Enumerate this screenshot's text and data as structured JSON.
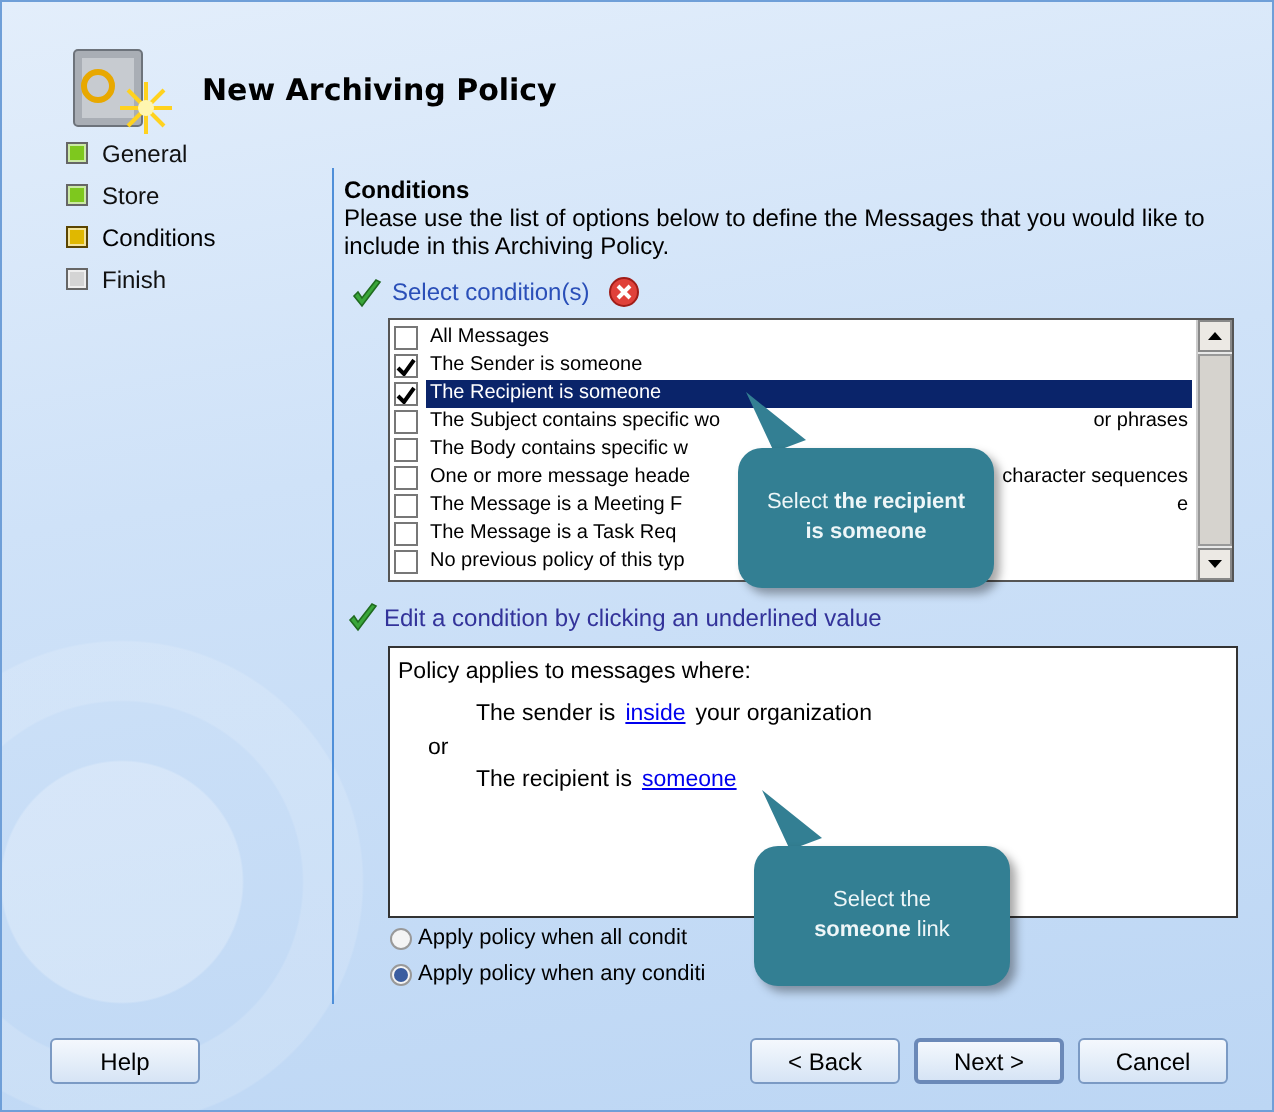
{
  "window": {
    "title": "New Archiving Policy"
  },
  "steps": [
    {
      "label": "General",
      "color": "#7ec81e",
      "selected": false
    },
    {
      "label": "Store",
      "color": "#7ec81e",
      "selected": false
    },
    {
      "label": "Conditions",
      "color": "#e0b800",
      "selected": true
    },
    {
      "label": "Finish",
      "color": "#d4d4d4",
      "selected": false
    }
  ],
  "section": {
    "heading": "Conditions",
    "description": "Please use the list of options below to define the Messages that you would like to include in this Archiving Policy."
  },
  "select_link": "Select condition(s)",
  "conditions": [
    {
      "label": "All Messages",
      "checked": false,
      "selected": false
    },
    {
      "label": "The Sender is someone",
      "checked": true,
      "selected": false
    },
    {
      "label": "The Recipient is someone",
      "checked": true,
      "selected": true
    },
    {
      "label": "The Subject contains specific wo",
      "label_end": "or phrases",
      "checked": false,
      "selected": false
    },
    {
      "label": "The Body contains specific w",
      "checked": false,
      "selected": false
    },
    {
      "label": "One or more message heade",
      "label_end": "character sequences",
      "checked": false,
      "selected": false
    },
    {
      "label": "The Message is a Meeting F",
      "label_end": "e",
      "checked": false,
      "selected": false
    },
    {
      "label": "The Message is a Task Req",
      "checked": false,
      "selected": false
    },
    {
      "label": "No previous policy of this typ",
      "checked": false,
      "selected": false
    }
  ],
  "edit_link": "Edit a condition by clicking an underlined value",
  "policy": {
    "heading": "Policy applies to messages where:",
    "lines": [
      {
        "kind": "clause",
        "before": "The sender is",
        "link": "inside",
        "after": "your organization"
      },
      {
        "kind": "connector",
        "text": "or"
      },
      {
        "kind": "clause",
        "before": "The recipient is",
        "link": "someone"
      }
    ]
  },
  "options": [
    {
      "label": "Apply policy when all condit",
      "selected": false
    },
    {
      "label": "Apply policy when any conditi",
      "selected": true
    }
  ],
  "callouts": [
    {
      "text": "Select **the recipient is someone**"
    },
    {
      "text": "Select the **someone** link"
    }
  ],
  "buttons": [
    {
      "label": "Help",
      "kind": "help"
    },
    {
      "label": "< Back",
      "kind": "nav"
    },
    {
      "label": "Next >",
      "kind": "default"
    },
    {
      "label": "Cancel",
      "kind": "nav"
    }
  ]
}
